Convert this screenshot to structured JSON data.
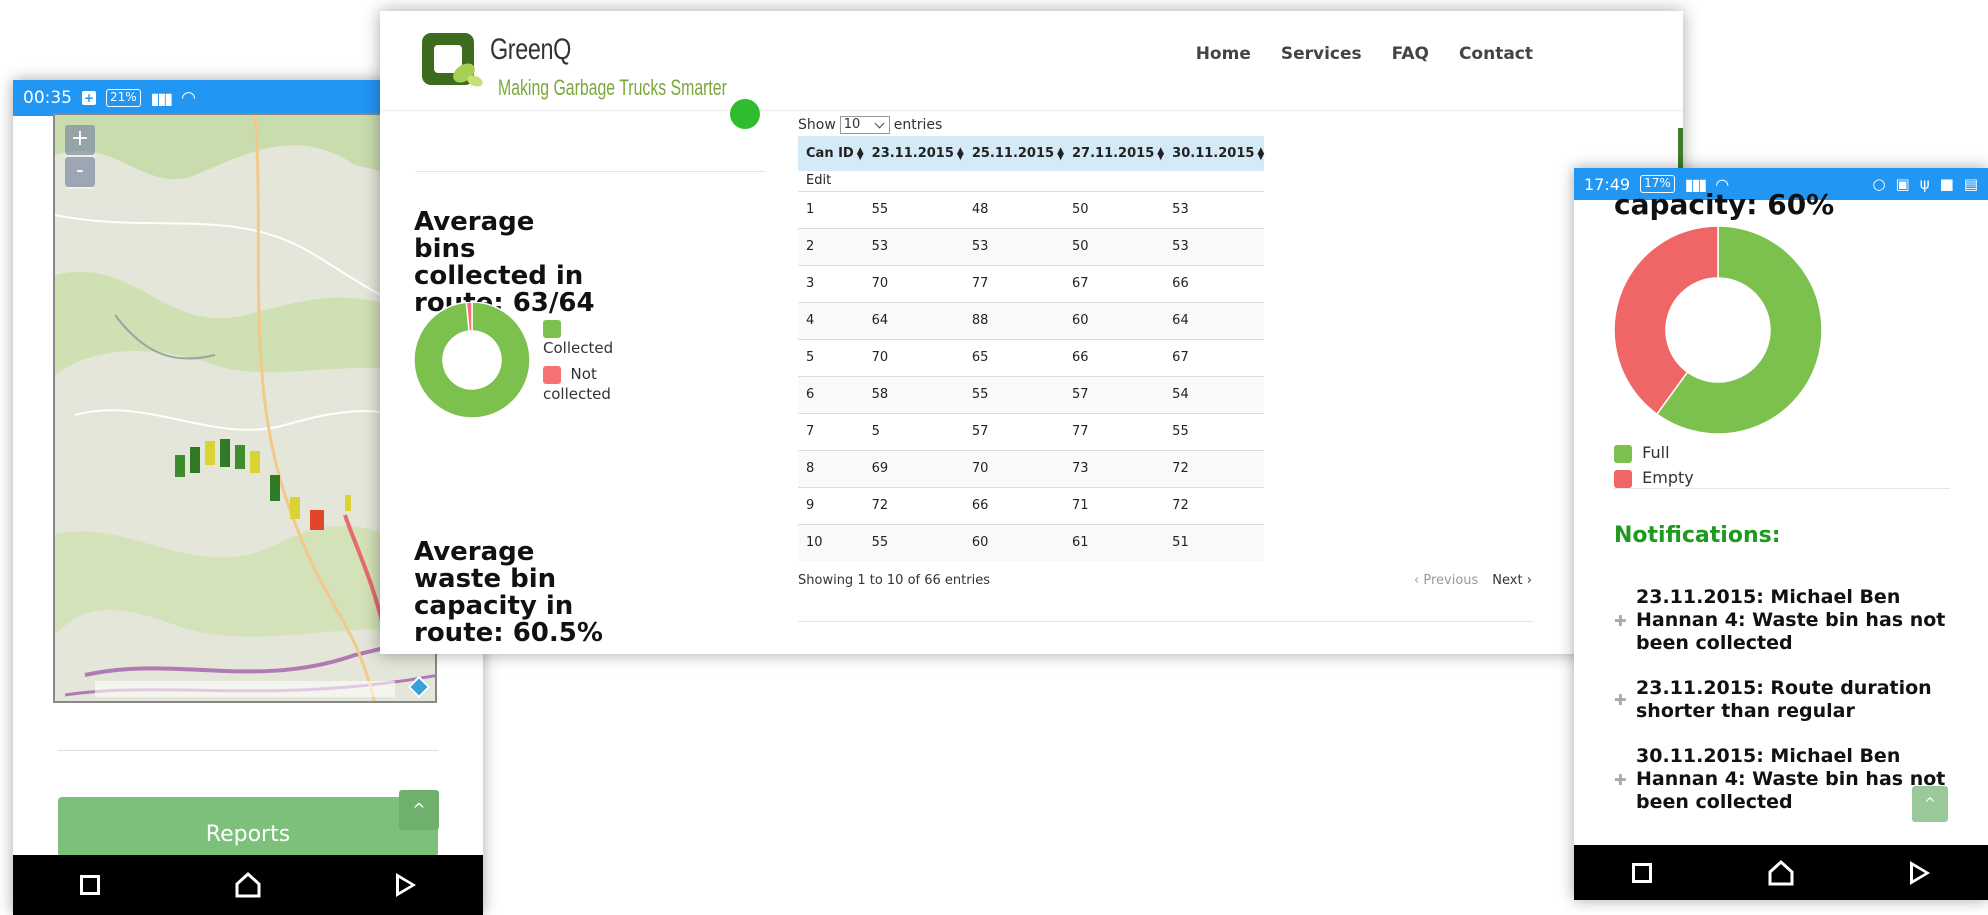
{
  "left_phone": {
    "status": {
      "time": "00:35",
      "battery": "21%",
      "charge_icon": "+"
    },
    "map": {
      "zoom_in": "+",
      "zoom_out": "-"
    },
    "reports_label": "Reports",
    "scroll_top_icon": "^"
  },
  "browser": {
    "logo": {
      "name": "GreenQ",
      "tagline": "Making Garbage Trucks Smarter"
    },
    "nav": [
      "Home",
      "Services",
      "FAQ",
      "Contact"
    ],
    "avg_bins_title": "Average bins collected in route: 63/64",
    "avg_bins_legend": [
      "Collected",
      "Not collected"
    ],
    "avg_capacity_title": "Average waste bin capacity in route: 60.5%",
    "table": {
      "show_prefix": "Show",
      "show_value": "10",
      "show_suffix": "entries",
      "columns": [
        "Can ID",
        "23.11.2015",
        "25.11.2015",
        "27.11.2015",
        "30.11.2015"
      ],
      "edit_label": "Edit",
      "rows": [
        [
          "1",
          "55",
          "48",
          "50",
          "53"
        ],
        [
          "2",
          "53",
          "53",
          "50",
          "53"
        ],
        [
          "3",
          "70",
          "77",
          "67",
          "66"
        ],
        [
          "4",
          "64",
          "88",
          "60",
          "64"
        ],
        [
          "5",
          "70",
          "65",
          "66",
          "67"
        ],
        [
          "6",
          "58",
          "55",
          "57",
          "54"
        ],
        [
          "7",
          "5",
          "57",
          "77",
          "55"
        ],
        [
          "8",
          "69",
          "70",
          "73",
          "72"
        ],
        [
          "9",
          "72",
          "66",
          "71",
          "72"
        ],
        [
          "10",
          "55",
          "60",
          "61",
          "51"
        ]
      ],
      "info": "Showing 1 to 10 of 66 entries",
      "prev": "Previous",
      "next": "Next"
    }
  },
  "right_phone": {
    "status": {
      "time": "17:49",
      "battery": "17%"
    },
    "capacity_title": "capacity: 60%",
    "legend": [
      "Full",
      "Empty"
    ],
    "notifications_title": "Notifications:",
    "notifications": [
      "23.11.2015: Michael Ben Hannan 4: Waste bin has not been collected",
      "23.11.2015: Route duration shorter than regular",
      "30.11.2015: Michael Ben Hannan 4: Waste bin has not been collected"
    ],
    "scroll_top_icon": "^"
  },
  "chart_data": [
    {
      "type": "pie",
      "labels": [
        "Collected",
        "Not collected"
      ],
      "values": [
        63,
        1
      ],
      "colors": [
        "#7cc04e",
        "#f47272"
      ],
      "title": "Average bins collected in route: 63/64"
    },
    {
      "type": "pie",
      "labels": [
        "Full",
        "Empty"
      ],
      "values": [
        60,
        40
      ],
      "colors": [
        "#7cc04e",
        "#f06565"
      ],
      "title": "capacity: 60%"
    }
  ],
  "colors": {
    "accent_green": "#7cc04e",
    "danger_red": "#f47272",
    "status_blue": "#2196f3",
    "notif_green": "#1f9a1f"
  }
}
